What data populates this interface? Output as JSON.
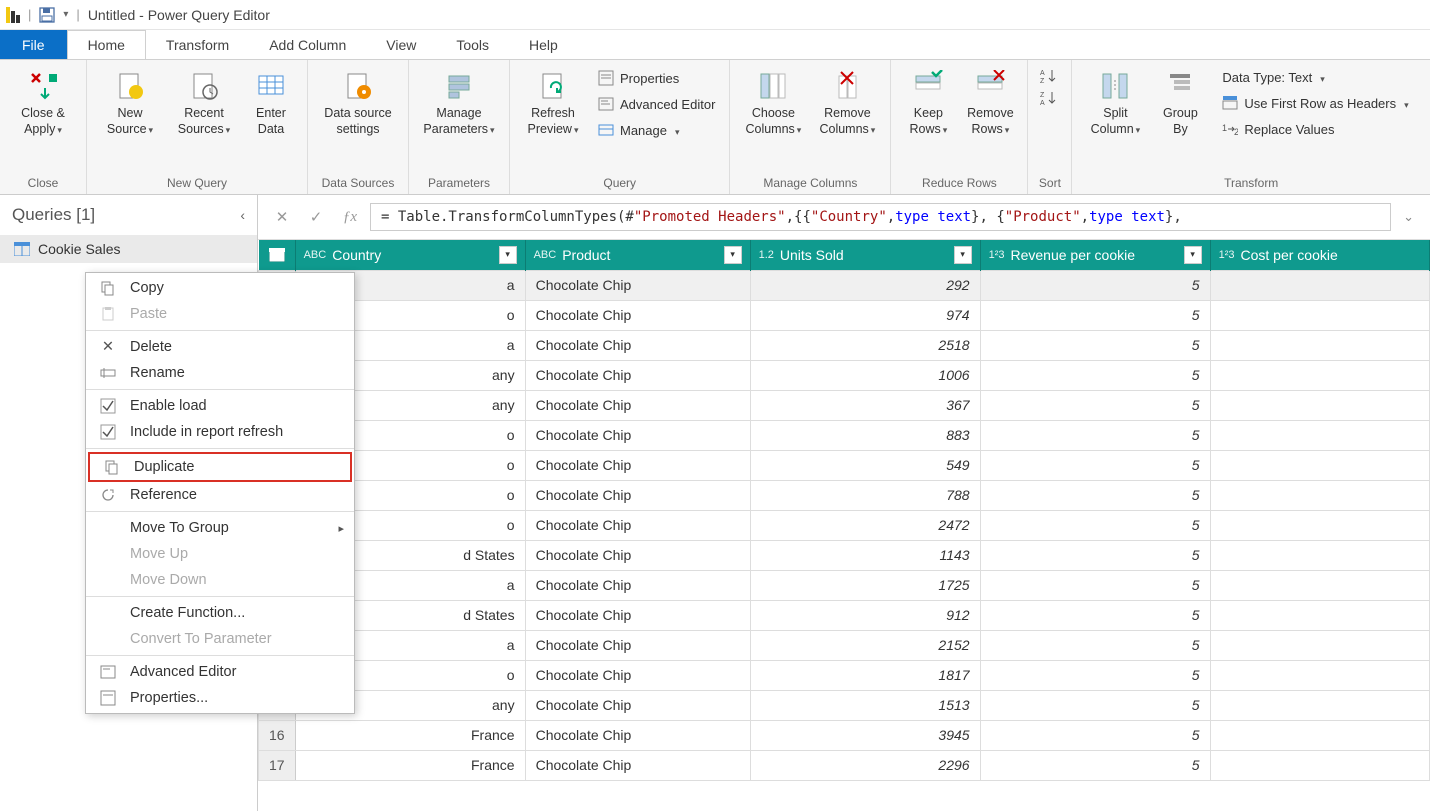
{
  "title_bar": {
    "app_title": "Untitled - Power Query Editor"
  },
  "ribbon_tabs": {
    "file": "File",
    "home": "Home",
    "transform": "Transform",
    "add_column": "Add Column",
    "view": "View",
    "tools": "Tools",
    "help": "Help"
  },
  "ribbon": {
    "close": {
      "close_apply": "Close & Apply",
      "group": "Close"
    },
    "new_query": {
      "new_source": "New Source",
      "recent_sources": "Recent Sources",
      "enter_data": "Enter Data",
      "group": "New Query"
    },
    "data_sources": {
      "settings": "Data source settings",
      "group": "Data Sources"
    },
    "parameters": {
      "manage_params": "Manage Parameters",
      "group": "Parameters"
    },
    "query": {
      "refresh": "Refresh Preview",
      "properties": "Properties",
      "advanced": "Advanced Editor",
      "manage": "Manage",
      "group": "Query"
    },
    "manage_cols": {
      "choose": "Choose Columns",
      "remove": "Remove Columns",
      "group": "Manage Columns"
    },
    "reduce": {
      "keep": "Keep Rows",
      "remove_rows": "Remove Rows",
      "group": "Reduce Rows"
    },
    "sort": {
      "group": "Sort"
    },
    "transform": {
      "split": "Split Column",
      "group_by": "Group By",
      "data_type": "Data Type: Text",
      "first_row": "Use First Row as Headers",
      "replace": "Replace Values",
      "group": "Transform"
    }
  },
  "queries_pane": {
    "title": "Queries [1]",
    "items": [
      {
        "name": "Cookie Sales"
      }
    ]
  },
  "formula": {
    "prefix": "= Table.TransformColumnTypes(#",
    "str1": "\"Promoted Headers\"",
    "mid1": ",{{",
    "str2": "\"Country\"",
    "mid2": ", ",
    "type1": "type text",
    "mid3": "}, {",
    "str3": "\"Product\"",
    "mid4": ", ",
    "type2": "type text",
    "end": "},"
  },
  "table": {
    "columns": [
      {
        "type_label": "ABC",
        "name": "Country"
      },
      {
        "type_label": "ABC",
        "name": "Product"
      },
      {
        "type_label": "1.2",
        "name": "Units Sold"
      },
      {
        "type_label": "1²3",
        "name": "Revenue per cookie"
      },
      {
        "type_label": "1²3",
        "name": "Cost per cookie"
      }
    ],
    "rows": [
      {
        "n": "",
        "country": "a",
        "product": "Chocolate Chip",
        "units": "292",
        "rev": "5",
        "cost": ""
      },
      {
        "n": "",
        "country": "o",
        "product": "Chocolate Chip",
        "units": "974",
        "rev": "5",
        "cost": ""
      },
      {
        "n": "",
        "country": "a",
        "product": "Chocolate Chip",
        "units": "2518",
        "rev": "5",
        "cost": ""
      },
      {
        "n": "",
        "country": "any",
        "product": "Chocolate Chip",
        "units": "1006",
        "rev": "5",
        "cost": ""
      },
      {
        "n": "",
        "country": "any",
        "product": "Chocolate Chip",
        "units": "367",
        "rev": "5",
        "cost": ""
      },
      {
        "n": "",
        "country": "o",
        "product": "Chocolate Chip",
        "units": "883",
        "rev": "5",
        "cost": ""
      },
      {
        "n": "",
        "country": "o",
        "product": "Chocolate Chip",
        "units": "549",
        "rev": "5",
        "cost": ""
      },
      {
        "n": "",
        "country": "o",
        "product": "Chocolate Chip",
        "units": "788",
        "rev": "5",
        "cost": ""
      },
      {
        "n": "",
        "country": "o",
        "product": "Chocolate Chip",
        "units": "2472",
        "rev": "5",
        "cost": ""
      },
      {
        "n": "",
        "country": "d States",
        "product": "Chocolate Chip",
        "units": "1143",
        "rev": "5",
        "cost": ""
      },
      {
        "n": "",
        "country": "a",
        "product": "Chocolate Chip",
        "units": "1725",
        "rev": "5",
        "cost": ""
      },
      {
        "n": "",
        "country": "d States",
        "product": "Chocolate Chip",
        "units": "912",
        "rev": "5",
        "cost": ""
      },
      {
        "n": "",
        "country": "a",
        "product": "Chocolate Chip",
        "units": "2152",
        "rev": "5",
        "cost": ""
      },
      {
        "n": "",
        "country": "o",
        "product": "Chocolate Chip",
        "units": "1817",
        "rev": "5",
        "cost": ""
      },
      {
        "n": "",
        "country": "any",
        "product": "Chocolate Chip",
        "units": "1513",
        "rev": "5",
        "cost": ""
      },
      {
        "n": "16",
        "country": "France",
        "product": "Chocolate Chip",
        "units": "3945",
        "rev": "5",
        "cost": ""
      },
      {
        "n": "17",
        "country": "France",
        "product": "Chocolate Chip",
        "units": "2296",
        "rev": "5",
        "cost": ""
      }
    ]
  },
  "context_menu": {
    "copy": "Copy",
    "paste": "Paste",
    "delete": "Delete",
    "rename": "Rename",
    "enable_load": "Enable load",
    "include_refresh": "Include in report refresh",
    "duplicate": "Duplicate",
    "reference": "Reference",
    "move_to_group": "Move To Group",
    "move_up": "Move Up",
    "move_down": "Move Down",
    "create_function": "Create Function...",
    "convert_param": "Convert To Parameter",
    "advanced_editor": "Advanced Editor",
    "properties": "Properties..."
  }
}
